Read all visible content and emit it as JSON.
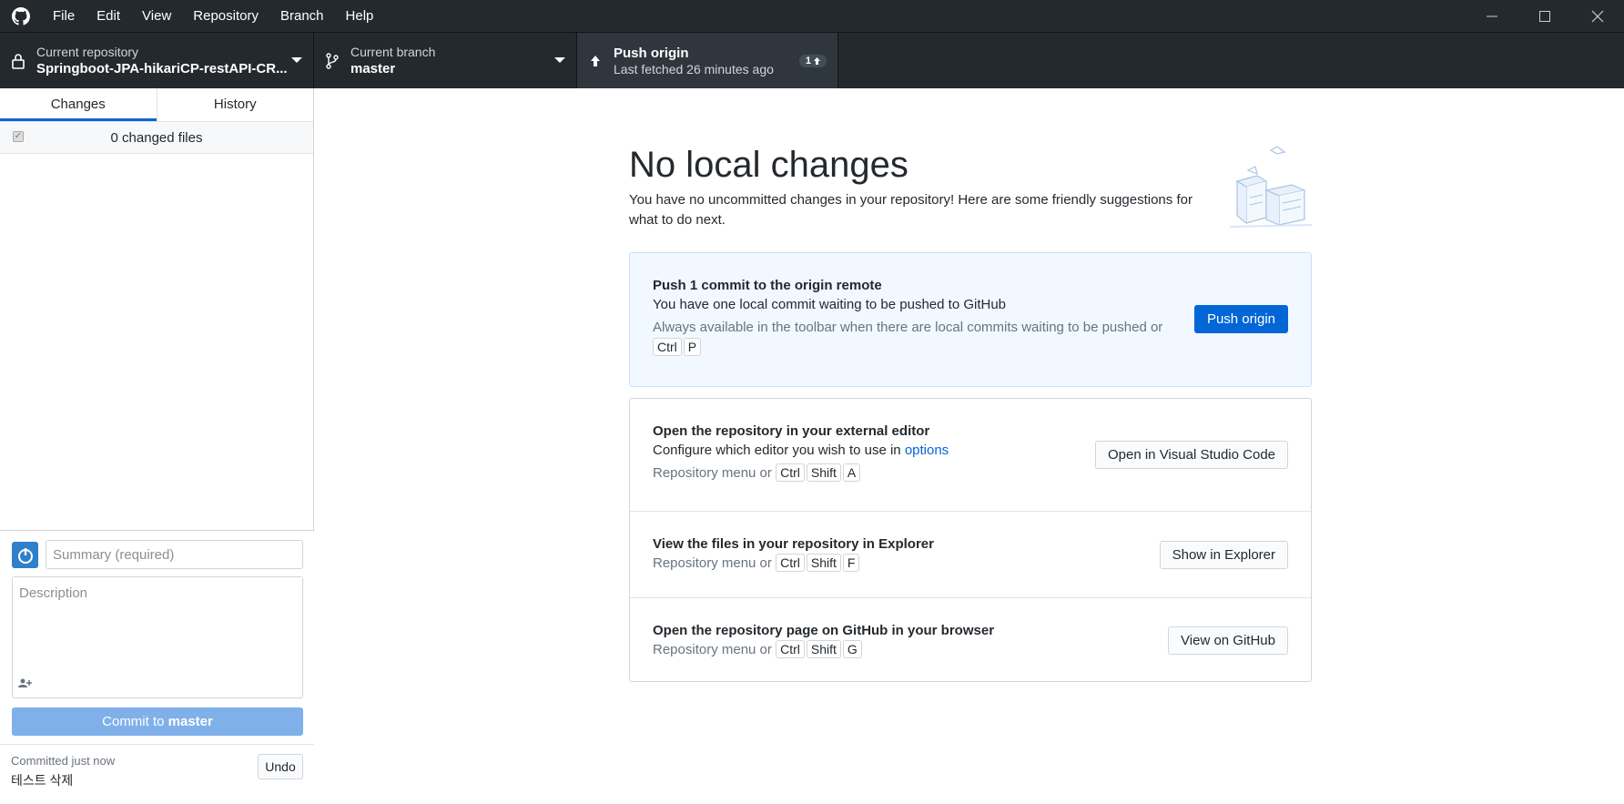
{
  "menu": [
    "File",
    "Edit",
    "View",
    "Repository",
    "Branch",
    "Help"
  ],
  "toolbar": {
    "repo_label": "Current repository",
    "repo_value": "Springboot-JPA-hikariCP-restAPI-CR...",
    "branch_label": "Current branch",
    "branch_value": "master",
    "push_label": "Push origin",
    "push_sub": "Last fetched 26 minutes ago",
    "push_count": "1"
  },
  "sidebar": {
    "tabs": [
      "Changes",
      "History"
    ],
    "changed_files": "0 changed files",
    "summary_placeholder": "Summary (required)",
    "description_placeholder": "Description",
    "commit_prefix": "Commit to ",
    "commit_branch": "master",
    "last_commit_label": "Committed just now",
    "last_commit_message": "테스트 삭제",
    "undo_label": "Undo"
  },
  "main": {
    "heading": "No local changes",
    "subtext": "You have no uncommitted changes in your repository! Here are some friendly suggestions for what to do next.",
    "push": {
      "title": "Push 1 commit to the origin remote",
      "desc": "You have one local commit waiting to be pushed to GitHub",
      "hint": "Always available in the toolbar when there are local commits waiting to be pushed or",
      "keys": [
        "Ctrl",
        "P"
      ],
      "button": "Push origin"
    },
    "editor": {
      "title": "Open the repository in your external editor",
      "desc": "Configure which editor you wish to use in ",
      "link": "options",
      "hint": "Repository menu or",
      "keys": [
        "Ctrl",
        "Shift",
        "A"
      ],
      "button": "Open in Visual Studio Code"
    },
    "explorer": {
      "title": "View the files in your repository in Explorer",
      "hint": "Repository menu or",
      "keys": [
        "Ctrl",
        "Shift",
        "F"
      ],
      "button": "Show in Explorer"
    },
    "github": {
      "title": "Open the repository page on GitHub in your browser",
      "hint": "Repository menu or",
      "keys": [
        "Ctrl",
        "Shift",
        "G"
      ],
      "button": "View on GitHub"
    }
  },
  "colors": {
    "accent": "#0366d6",
    "titlebar": "#24292e",
    "commit_button": "#7fb0ea"
  }
}
